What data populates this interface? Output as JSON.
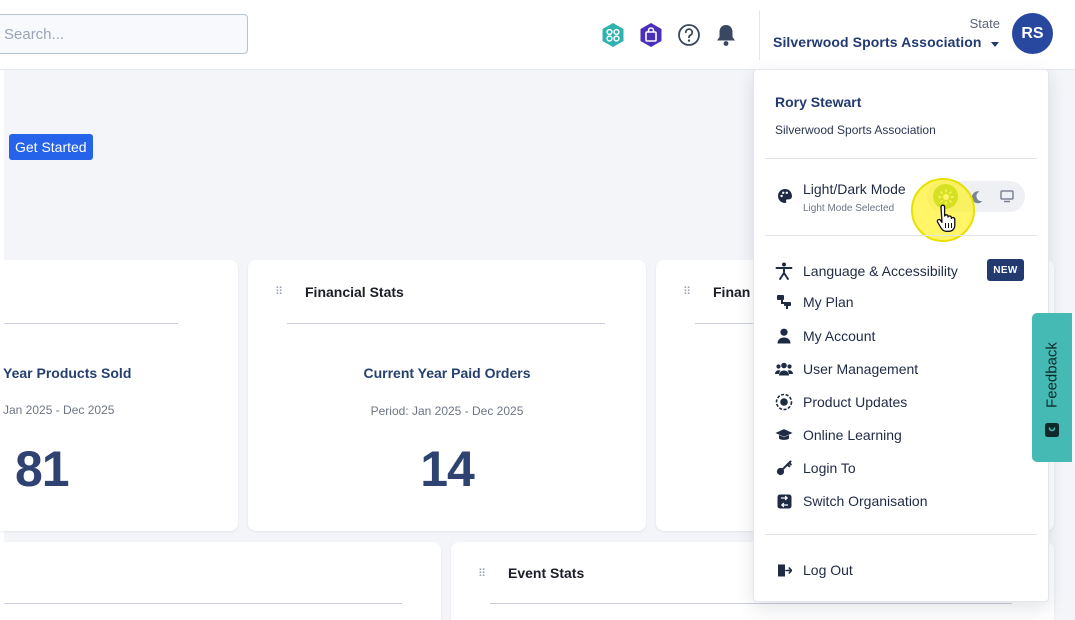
{
  "header": {
    "search_placeholder": "Search...",
    "state_label": "State",
    "organisation": "Silverwood Sports Association",
    "avatar_initials": "RS"
  },
  "hero": {
    "cta_label": "Get Started"
  },
  "cards": [
    {
      "title": "",
      "stat_label": "Year Products Sold",
      "period": "Jan 2025 - Dec 2025",
      "value": "81"
    },
    {
      "title": "Financial Stats",
      "stat_label": "Current Year Paid Orders",
      "period": "Period: Jan 2025 - Dec 2025",
      "value": "14"
    },
    {
      "title": "Finan"
    },
    {
      "title": ""
    },
    {
      "title": "Event Stats"
    }
  ],
  "user_menu": {
    "user_name": "Rory Stewart",
    "user_org": "Silverwood Sports Association",
    "mode": {
      "title": "Light/Dark Mode",
      "subtitle": "Light Mode Selected",
      "selected": "light"
    },
    "items": [
      {
        "label": "Language & Accessibility",
        "icon": "accessibility-icon",
        "badge": "NEW"
      },
      {
        "label": "My Plan",
        "icon": "plan-icon"
      },
      {
        "label": "My Account",
        "icon": "user-icon"
      },
      {
        "label": "User Management",
        "icon": "users-icon"
      },
      {
        "label": "Product Updates",
        "icon": "updates-icon"
      },
      {
        "label": "Online Learning",
        "icon": "graduation-cap-icon"
      },
      {
        "label": "Login To",
        "icon": "key-icon"
      },
      {
        "label": "Switch Organisation",
        "icon": "switch-icon"
      }
    ],
    "logout_label": "Log Out"
  },
  "feedback": {
    "label": "Feedback"
  },
  "colors": {
    "primary": "#223a70",
    "accent_blue": "#2563eb",
    "light_mode_green": "#8dc63f",
    "feedback_teal": "#45b9b4",
    "highlight_yellow": "#fff014"
  }
}
